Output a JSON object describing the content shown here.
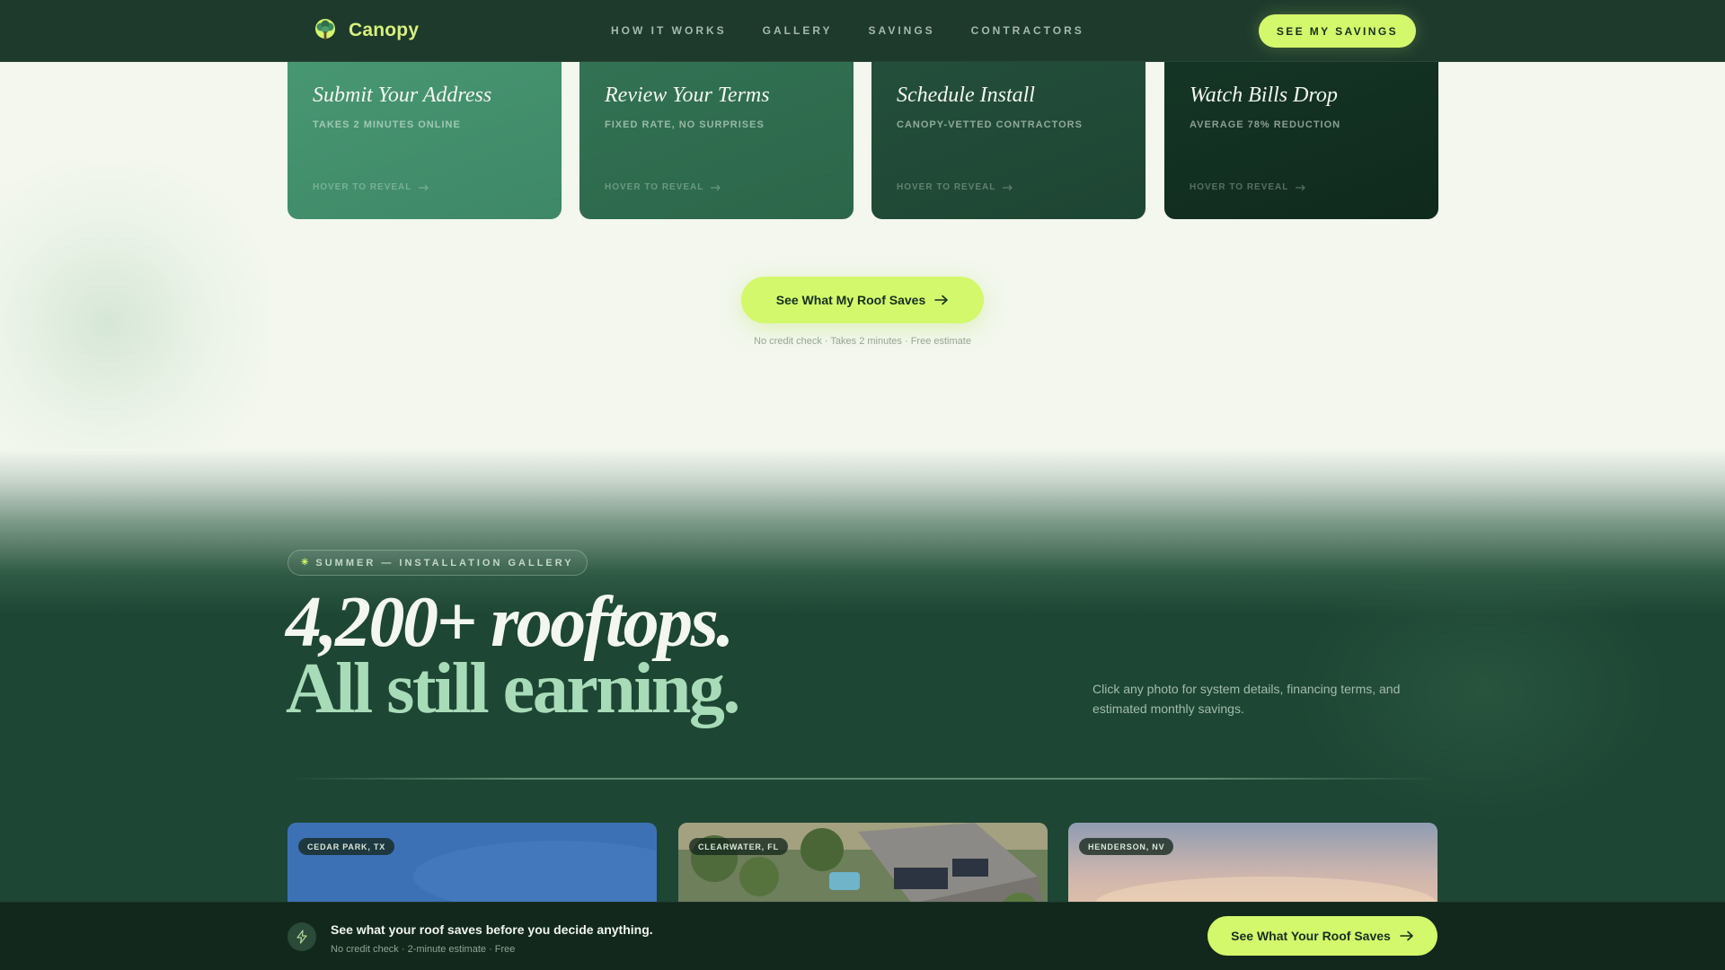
{
  "nav": {
    "brand": "Canopy",
    "links": [
      "HOW IT WORKS",
      "GALLERY",
      "SAVINGS",
      "CONTRACTORS"
    ],
    "cta": "SEE MY SAVINGS"
  },
  "steps": [
    {
      "title": "Submit Your Address",
      "subtitle": "TAKES 2 MINUTES ONLINE",
      "hover": "HOVER TO REVEAL"
    },
    {
      "title": "Review Your Terms",
      "subtitle": "FIXED RATE, NO SURPRISES",
      "hover": "HOVER TO REVEAL"
    },
    {
      "title": "Schedule Install",
      "subtitle": "CANOPY-VETTED CONTRACTORS",
      "hover": "HOVER TO REVEAL"
    },
    {
      "title": "Watch Bills Drop",
      "subtitle": "AVERAGE 78% REDUCTION",
      "hover": "HOVER TO REVEAL"
    }
  ],
  "mid_cta": {
    "label": "See What My Roof Saves",
    "note": "No credit check · Takes 2 minutes · Free estimate"
  },
  "gallery": {
    "badge_icon": "✳",
    "badge": "SUMMER — INSTALLATION GALLERY",
    "headline_line1": "4,200+ rooftops.",
    "headline_line2": "All still earning.",
    "description": "Click any photo for system details, financing terms, and estimated monthly savings.",
    "photos": [
      {
        "location": "CEDAR PARK, TX"
      },
      {
        "location": "CLEARWATER, FL"
      },
      {
        "location": "HENDERSON, NV"
      }
    ]
  },
  "sticky": {
    "title": "See what your roof saves before you decide anything.",
    "subtitle": "No credit check · 2-minute estimate · Free",
    "cta": "See What Your Roof Saves"
  },
  "colors": {
    "accent": "#d4f86c",
    "nav_bg": "#1d3a2d",
    "gallery_bg": "#1d4634",
    "sticky_bg": "#12281c"
  },
  "icons": {
    "brand": "tree-logo-icon",
    "arrow": "arrow-right-icon",
    "sticky": "lightning-bolt-icon"
  }
}
